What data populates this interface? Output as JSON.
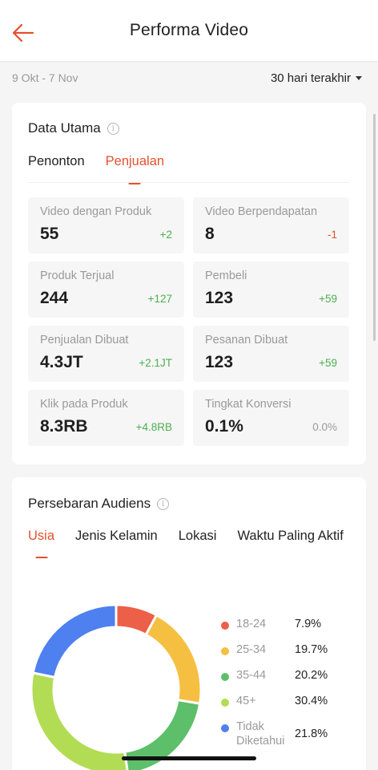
{
  "header": {
    "title": "Performa Video",
    "back_icon": "arrow-left-icon"
  },
  "date_row": {
    "range": "9 Okt - 7 Nov",
    "period": "30 hari terakhir"
  },
  "main_card": {
    "title": "Data Utama",
    "tabs": [
      {
        "label": "Penonton"
      },
      {
        "label": "Penjualan"
      }
    ],
    "active_tab": 1,
    "metrics": [
      {
        "label": "Video dengan Produk",
        "value": "55",
        "change": "+2",
        "trend": "positive"
      },
      {
        "label": "Video Berpendapatan",
        "value": "8",
        "change": "-1",
        "trend": "negative"
      },
      {
        "label": "Produk Terjual",
        "value": "244",
        "change": "+127",
        "trend": "positive"
      },
      {
        "label": "Pembeli",
        "value": "123",
        "change": "+59",
        "trend": "positive"
      },
      {
        "label": "Penjualan Dibuat",
        "value": "4.3JT",
        "change": "+2.1JT",
        "trend": "positive"
      },
      {
        "label": "Pesanan Dibuat",
        "value": "123",
        "change": "+59",
        "trend": "positive"
      },
      {
        "label": "Klik pada Produk",
        "value": "8.3RB",
        "change": "+4.8RB",
        "trend": "positive"
      },
      {
        "label": "Tingkat Konversi",
        "value": "0.1%",
        "change": "0.0%",
        "trend": "neutral"
      }
    ]
  },
  "audience_card": {
    "title": "Persebaran Audiens",
    "tabs": [
      {
        "label": "Usia"
      },
      {
        "label": "Jenis Kelamin"
      },
      {
        "label": "Lokasi"
      },
      {
        "label": "Waktu Paling Aktif"
      }
    ],
    "active_tab": 0
  },
  "chart_data": {
    "type": "pie",
    "donut": true,
    "categories": [
      "18-24",
      "25-34",
      "35-44",
      "45+",
      "Tidak Diketahui"
    ],
    "values": [
      7.9,
      19.7,
      20.2,
      30.4,
      21.8
    ],
    "value_labels": [
      "7.9%",
      "19.7%",
      "20.2%",
      "30.4%",
      "21.8%"
    ],
    "colors": [
      "#ec5f48",
      "#f5bf42",
      "#5dbf6a",
      "#b3dc55",
      "#4f80ef"
    ],
    "legend_position": "right"
  },
  "colors": {
    "accent": "#e5502e",
    "positive": "#4caf50",
    "negative": "#e5502e",
    "neutral": "#9a9a9a"
  }
}
